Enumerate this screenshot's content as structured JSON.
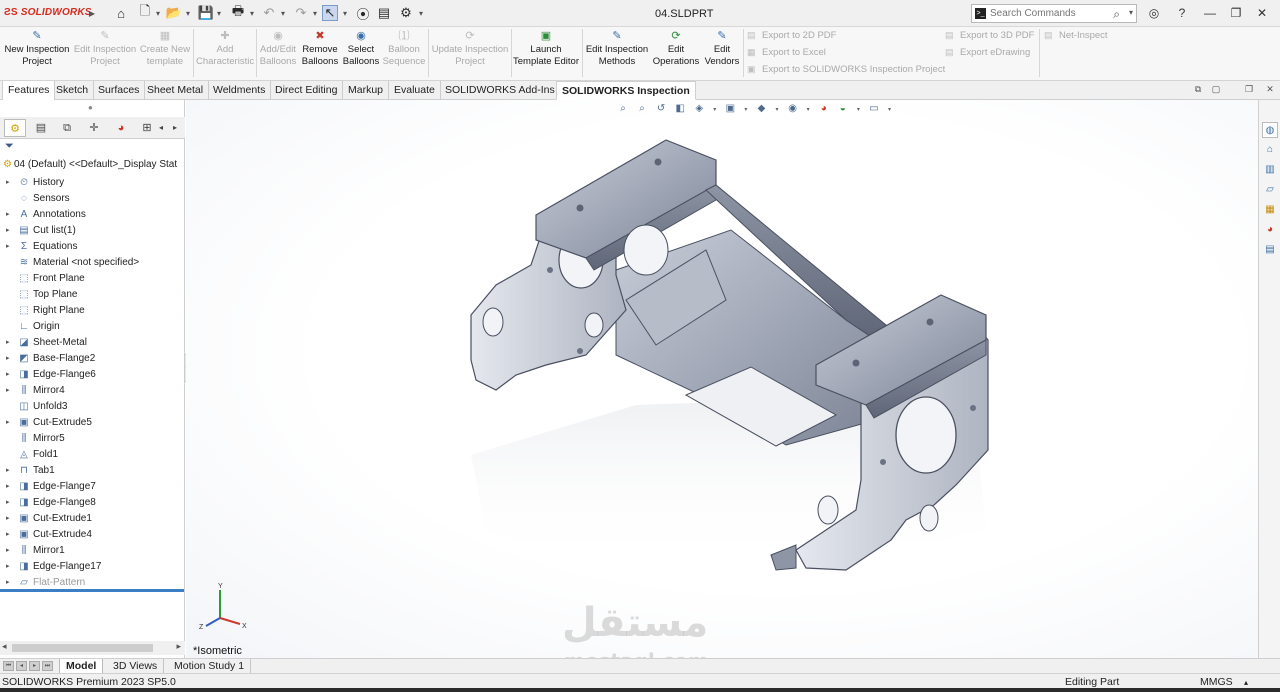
{
  "app": {
    "brand": "SOLIDWORKS",
    "document_title": "04.SLDPRT"
  },
  "quick_access": {
    "icons": [
      "home-icon",
      "new-document-icon",
      "open-icon",
      "save-icon",
      "print-icon",
      "undo-icon",
      "redo-icon",
      "select-arrow-icon",
      "rebuild-icon",
      "file-properties-icon",
      "options-gear-icon"
    ]
  },
  "search": {
    "placeholder": "Search Commands"
  },
  "ribbon": {
    "new_inspection_project": "New Inspection Project",
    "edit_inspection_project": "Edit Inspection Project",
    "create_new_template": "Create New template",
    "add_characteristic": "Add Characteristic",
    "add_edit_balloons": "Add/Edit Balloons",
    "remove_balloons": "Remove Balloons",
    "select_balloons": "Select Balloons",
    "balloon_sequence": "Balloon Sequence",
    "update_inspection_project": "Update Inspection Project",
    "launch_template_editor": "Launch Template Editor",
    "edit_inspection_methods": "Edit Inspection Methods",
    "edit_operations": "Edit Operations",
    "edit_vendors": "Edit Vendors",
    "export_2d_pdf": "Export to 2D PDF",
    "export_excel": "Export to Excel",
    "export_sw_inspection_project": "Export to SOLIDWORKS Inspection Project",
    "export_3d_pdf": "Export to 3D PDF",
    "export_edrawing": "Export eDrawing",
    "net_inspect": "Net-Inspect"
  },
  "command_tabs": [
    "Features",
    "Sketch",
    "Surfaces",
    "Sheet Metal",
    "Weldments",
    "Direct Editing",
    "Markup",
    "Evaluate",
    "SOLIDWORKS Add-Ins",
    "SOLIDWORKS Inspection"
  ],
  "active_command_tab": "SOLIDWORKS Inspection",
  "feature_manager": {
    "root": "04 (Default) <<Default>_Display Stat",
    "items": [
      {
        "label": "History",
        "icon": "history-icon",
        "expandable": true
      },
      {
        "label": "Sensors",
        "icon": "sensors-icon",
        "expandable": false
      },
      {
        "label": "Annotations",
        "icon": "annotations-icon",
        "expandable": true
      },
      {
        "label": "Cut list(1)",
        "icon": "cut-list-icon",
        "expandable": true
      },
      {
        "label": "Equations",
        "icon": "equations-icon",
        "expandable": true
      },
      {
        "label": "Material <not specified>",
        "icon": "material-icon",
        "expandable": false
      },
      {
        "label": "Front Plane",
        "icon": "plane-icon",
        "expandable": false
      },
      {
        "label": "Top Plane",
        "icon": "plane-icon",
        "expandable": false
      },
      {
        "label": "Right Plane",
        "icon": "plane-icon",
        "expandable": false
      },
      {
        "label": "Origin",
        "icon": "origin-icon",
        "expandable": false
      },
      {
        "label": "Sheet-Metal",
        "icon": "sheet-metal-icon",
        "expandable": true
      },
      {
        "label": "Base-Flange2",
        "icon": "base-flange-icon",
        "expandable": true
      },
      {
        "label": "Edge-Flange6",
        "icon": "edge-flange-icon",
        "expandable": true
      },
      {
        "label": "Mirror4",
        "icon": "mirror-icon",
        "expandable": true
      },
      {
        "label": "Unfold3",
        "icon": "unfold-icon",
        "expandable": false
      },
      {
        "label": "Cut-Extrude5",
        "icon": "cut-extrude-icon",
        "expandable": true
      },
      {
        "label": "Mirror5",
        "icon": "mirror-icon",
        "expandable": false
      },
      {
        "label": "Fold1",
        "icon": "fold-icon",
        "expandable": false
      },
      {
        "label": "Tab1",
        "icon": "tab-icon",
        "expandable": true
      },
      {
        "label": "Edge-Flange7",
        "icon": "edge-flange-icon",
        "expandable": true
      },
      {
        "label": "Edge-Flange8",
        "icon": "edge-flange-icon",
        "expandable": true
      },
      {
        "label": "Cut-Extrude1",
        "icon": "cut-extrude-icon",
        "expandable": true
      },
      {
        "label": "Cut-Extrude4",
        "icon": "cut-extrude-icon",
        "expandable": true
      },
      {
        "label": "Mirror1",
        "icon": "mirror-icon",
        "expandable": true
      },
      {
        "label": "Edge-Flange17",
        "icon": "edge-flange-icon",
        "expandable": true
      },
      {
        "label": "Flat-Pattern",
        "icon": "flat-pattern-icon",
        "expandable": true,
        "suppressed": true
      }
    ]
  },
  "viewport": {
    "view_name": "*Isometric",
    "watermark_arabic": "مستقل",
    "watermark_latin": "mostaql.com",
    "triad_axes": [
      "Y",
      "X",
      "Z"
    ]
  },
  "bottom_tabs": [
    "Model",
    "3D Views",
    "Motion Study 1"
  ],
  "active_bottom_tab": "Model",
  "status": {
    "version": "SOLIDWORKS Premium 2023 SP5.0",
    "mode": "Editing Part",
    "units": "MMGS"
  },
  "colors": {
    "brand_red": "#d52b1e",
    "selection_blue": "#3b7ec6",
    "part_metal": "#9aa3b4"
  }
}
